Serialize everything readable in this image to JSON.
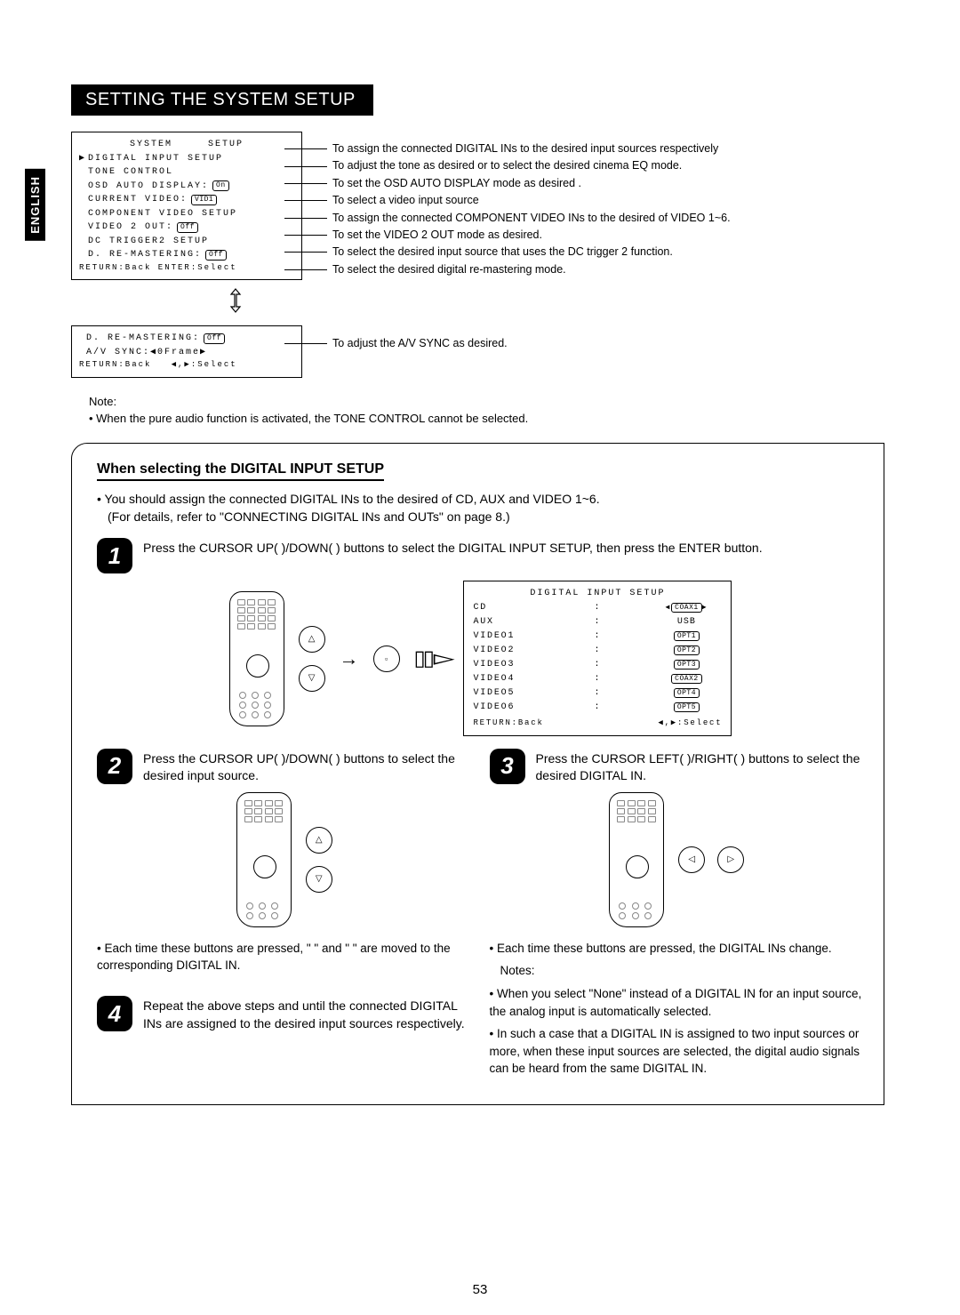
{
  "lang_tab": "ENGLISH",
  "section_title": "SETTING THE SYSTEM SETUP",
  "osd1": {
    "title": "SYSTEM     SETUP",
    "lines": [
      {
        "text": "DIGITAL INPUT SETUP",
        "marker": "▶",
        "tag": ""
      },
      {
        "text": "TONE CONTROL",
        "marker": " ",
        "tag": ""
      },
      {
        "text": "OSD AUTO DISPLAY:",
        "marker": " ",
        "tag": "On"
      },
      {
        "text": "CURRENT VIDEO:",
        "marker": " ",
        "tag": "VID1"
      },
      {
        "text": "COMPONENT VIDEO SETUP",
        "marker": " ",
        "tag": ""
      },
      {
        "text": "VIDEO 2 OUT:",
        "marker": " ",
        "tag": "Off"
      },
      {
        "text": "DC TRIGGER2 SETUP",
        "marker": " ",
        "tag": ""
      },
      {
        "text": "D. RE-MASTERING:",
        "marker": " ",
        "tag": "Off"
      }
    ],
    "footer": "RETURN:Back ENTER:Select"
  },
  "osd2": {
    "lines": [
      {
        "text": "D. RE-MASTERING:",
        "tag": "Off"
      },
      {
        "text": "A/V SYNC:◀0Frame▶",
        "tag": ""
      }
    ],
    "footer": "RETURN:Back   ◀,▶:Select"
  },
  "descriptions": [
    "To assign the connected DIGITAL INs to the desired input sources respectively",
    "To adjust the tone as desired or to select the desired cinema EQ mode.",
    "To set the OSD AUTO DISPLAY mode as desired .",
    "To select a video input source",
    "To assign the connected COMPONENT VIDEO INs to the desired of VIDEO 1~6.",
    "To set the VIDEO 2 OUT mode as desired.",
    "To select the desired input source that uses the DC trigger 2 function.",
    "To select the desired digital re-mastering mode."
  ],
  "desc_av_sync": "To adjust the A/V SYNC as desired.",
  "note_label": "Note:",
  "note_text": "• When the pure audio function is activated, the TONE CONTROL cannot be selected.",
  "subsection_title": "When selecting the DIGITAL INPUT SETUP",
  "intro1": "• You should assign the connected DIGITAL INs to the desired of CD, AUX and VIDEO 1~6.",
  "intro2": "(For details, refer to \"CONNECTING DIGITAL INs and OUTs\" on page 8.)",
  "step1": "Press the CURSOR UP(   )/DOWN(   ) buttons to select the DIGITAL INPUT SETUP, then press the ENTER button.",
  "step2": "Press the CURSOR UP(   )/DOWN(   ) buttons to select the desired input source.",
  "step3": "Press the CURSOR LEFT(   )/RIGHT(   ) buttons to select the desired DIGITAL IN.",
  "step4": "Repeat the above steps     and     until the connected DIGITAL INs are assigned to the desired input sources respectively.",
  "step2_note": "• Each time these buttons are pressed, \"   \" and \"   \" are moved to the corresponding DIGITAL IN.",
  "step3_note1": "• Each time these buttons are pressed, the DIGITAL INs change.",
  "step3_notes_label": "Notes:",
  "step3_note2": "• When you select \"None\" instead of a DIGITAL IN for an input source, the analog input is automatically selected.",
  "step3_note3": "• In such a case that a DIGITAL IN is assigned to two input sources or more, when these input sources are selected, the digital audio signals can be heard from the same DIGITAL IN.",
  "digital_input_box": {
    "title": "DIGITAL INPUT SETUP",
    "rows": [
      {
        "label": "CD",
        "val": "COAX1",
        "sel": true
      },
      {
        "label": "AUX",
        "val": "USB",
        "sel": false
      },
      {
        "label": "VIDEO1",
        "val": "OPT1",
        "sel": false
      },
      {
        "label": "VIDEO2",
        "val": "OPT2",
        "sel": false
      },
      {
        "label": "VIDEO3",
        "val": "OPT3",
        "sel": false
      },
      {
        "label": "VIDEO4",
        "val": "COAX2",
        "sel": false
      },
      {
        "label": "VIDEO5",
        "val": "OPT4",
        "sel": false
      },
      {
        "label": "VIDEO6",
        "val": "OPT5",
        "sel": false
      }
    ],
    "footer_l": "RETURN:Back",
    "footer_r": "◀,▶:Select"
  },
  "step_numbers": {
    "s1": "1",
    "s2": "2",
    "s3": "3",
    "s4": "4"
  },
  "page_number": "53"
}
